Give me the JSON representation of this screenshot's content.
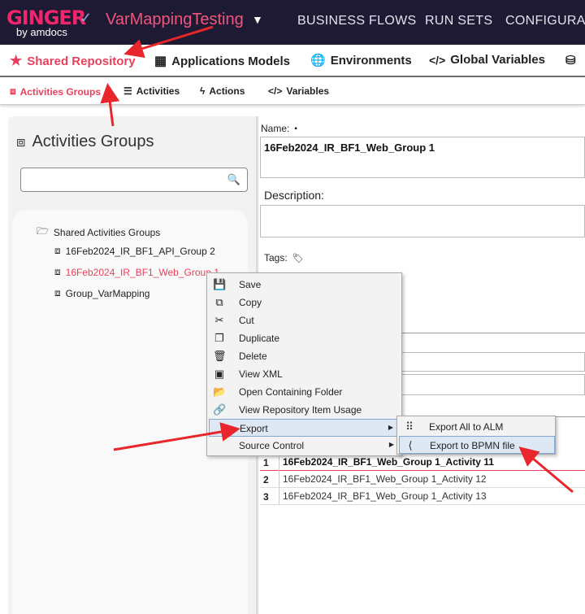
{
  "header": {
    "logo_text": "GINGER",
    "logo_sub": "by amdocs",
    "solution_name": "VarMappingTesting",
    "nav": [
      "BUSINESS FLOWS",
      "RUN SETS",
      "CONFIGURATI"
    ]
  },
  "main_tabs": [
    {
      "label": "Shared Repository",
      "icon": "star-icon",
      "active": true
    },
    {
      "label": "Applications Models",
      "icon": "grid-icon",
      "active": false
    },
    {
      "label": "Environments",
      "icon": "globe-icon",
      "active": false
    },
    {
      "label": "Global  Variables",
      "icon": "code-icon",
      "active": false
    }
  ],
  "sub_tabs": [
    {
      "label": "Activities Groups",
      "icon": "activities-group-icon",
      "active": true
    },
    {
      "label": "Activities",
      "icon": "list-icon",
      "active": false
    },
    {
      "label": "Actions",
      "icon": "bolt-icon",
      "active": false
    },
    {
      "label": "Variables",
      "icon": "code-icon",
      "active": false
    }
  ],
  "left_panel": {
    "title": "Activities Groups",
    "search_placeholder": "",
    "tree": {
      "root": "Shared Activities Groups",
      "items": [
        "16Feb2024_IR_BF1_API_Group 2",
        "16Feb2024_IR_BF1_Web_Group 1",
        "Group_VarMapping"
      ],
      "selected_index": 1
    }
  },
  "details": {
    "name_label": "Name:",
    "name_value": "16Feb2024_IR_BF1_Web_Group 1",
    "description_label": "Description:",
    "tags_label": "Tags:"
  },
  "activities_grid": [
    {
      "num": "1",
      "name": "16Feb2024_IR_BF1_Web_Group 1_Activity 11"
    },
    {
      "num": "2",
      "name": "16Feb2024_IR_BF1_Web_Group 1_Activity 12"
    },
    {
      "num": "3",
      "name": "16Feb2024_IR_BF1_Web_Group 1_Activity 13"
    }
  ],
  "context_menu": [
    {
      "label": "Save",
      "icon": "save-icon",
      "glyph": "💾"
    },
    {
      "label": "Copy",
      "icon": "copy-icon",
      "glyph": "⧉"
    },
    {
      "label": "Cut",
      "icon": "scissors-icon",
      "glyph": "✂"
    },
    {
      "label": "Duplicate",
      "icon": "duplicate-icon",
      "glyph": "❐"
    },
    {
      "label": "Delete",
      "icon": "trash-icon",
      "glyph": "🗑"
    },
    {
      "label": "View XML",
      "icon": "xml-icon",
      "glyph": "▣"
    },
    {
      "label": "Open Containing Folder",
      "icon": "folder-icon",
      "glyph": "📂"
    },
    {
      "label": "View Repository Item Usage",
      "icon": "link-icon",
      "glyph": "🔗"
    },
    {
      "label": "Export",
      "icon": "",
      "glyph": "",
      "submenu": true,
      "highlighted": true
    },
    {
      "label": "Source Control",
      "icon": "",
      "glyph": "",
      "submenu": true
    }
  ],
  "export_submenu": [
    {
      "label": "Export All to ALM",
      "icon": "alm-icon",
      "glyph": "⠿"
    },
    {
      "label": "Export to BPMN file",
      "icon": "share-icon",
      "glyph": "⟨"
    }
  ],
  "colors": {
    "accent": "#e8405b",
    "topbar": "#1f1a33",
    "annotation": "#e8262b"
  }
}
